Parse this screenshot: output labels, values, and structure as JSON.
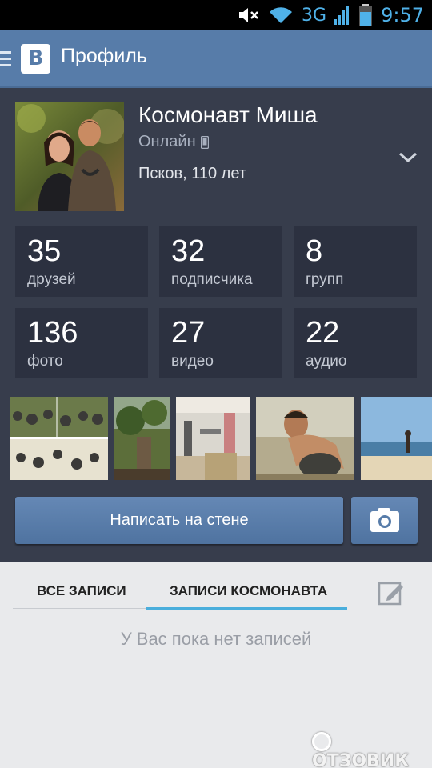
{
  "statusbar": {
    "network": "3G",
    "time": "9:57"
  },
  "header": {
    "logo": "В",
    "title": "Профиль"
  },
  "profile": {
    "name": "Космонавт Миша",
    "status": "Онлайн",
    "location": "Псков, 110 лет"
  },
  "stats": [
    {
      "value": "35",
      "label": "друзей"
    },
    {
      "value": "32",
      "label": "подписчика"
    },
    {
      "value": "8",
      "label": "групп"
    },
    {
      "value": "136",
      "label": "фото"
    },
    {
      "value": "27",
      "label": "видео"
    },
    {
      "value": "22",
      "label": "аудио"
    }
  ],
  "wall_button": "Написать на стене",
  "tabs": {
    "all": "ВСЕ ЗАПИСИ",
    "own": "ЗАПИСИ КОСМОНАВТА"
  },
  "empty_message": "У Вас пока нет записей",
  "watermark": "ОТЗОВИК",
  "colors": {
    "header": "#577ca9",
    "panel": "#373d4c",
    "tile": "#2c3140",
    "accent": "#4aaedc"
  }
}
